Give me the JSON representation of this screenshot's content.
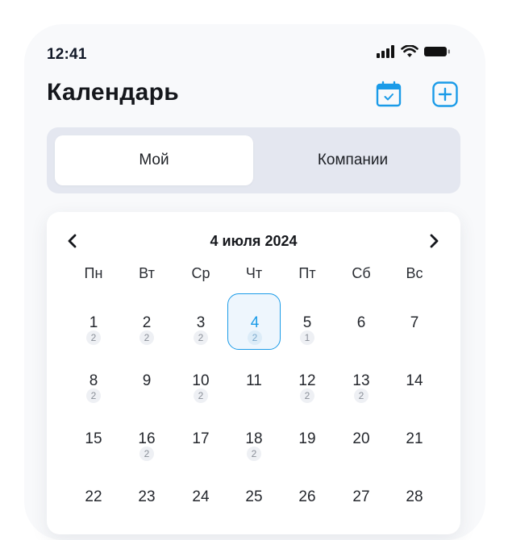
{
  "status": {
    "time": "12:41"
  },
  "header": {
    "title": "Календарь",
    "calendar_icon": "calendar-check-icon",
    "add_icon": "plus-icon"
  },
  "segment": {
    "my_label": "Мой",
    "companies_label": "Компании"
  },
  "calendar": {
    "month_title": "4 июля 2024",
    "weekdays": [
      "Пн",
      "Вт",
      "Ср",
      "Чт",
      "Пт",
      "Сб",
      "Вс"
    ],
    "selected_day": "4",
    "days": [
      {
        "n": "1",
        "c": "2"
      },
      {
        "n": "2",
        "c": "2"
      },
      {
        "n": "3",
        "c": "2"
      },
      {
        "n": "4",
        "c": "2"
      },
      {
        "n": "5",
        "c": "1"
      },
      {
        "n": "6",
        "c": ""
      },
      {
        "n": "7",
        "c": ""
      },
      {
        "n": "8",
        "c": "2"
      },
      {
        "n": "9",
        "c": ""
      },
      {
        "n": "10",
        "c": "2"
      },
      {
        "n": "11",
        "c": ""
      },
      {
        "n": "12",
        "c": "2"
      },
      {
        "n": "13",
        "c": "2"
      },
      {
        "n": "14",
        "c": ""
      },
      {
        "n": "15",
        "c": ""
      },
      {
        "n": "16",
        "c": "2"
      },
      {
        "n": "17",
        "c": ""
      },
      {
        "n": "18",
        "c": "2"
      },
      {
        "n": "19",
        "c": ""
      },
      {
        "n": "20",
        "c": ""
      },
      {
        "n": "21",
        "c": ""
      },
      {
        "n": "22",
        "c": ""
      },
      {
        "n": "23",
        "c": ""
      },
      {
        "n": "24",
        "c": ""
      },
      {
        "n": "25",
        "c": ""
      },
      {
        "n": "26",
        "c": ""
      },
      {
        "n": "27",
        "c": ""
      },
      {
        "n": "28",
        "c": ""
      }
    ]
  },
  "colors": {
    "accent": "#1a9be8",
    "segment_bg": "#e4e7f0"
  }
}
